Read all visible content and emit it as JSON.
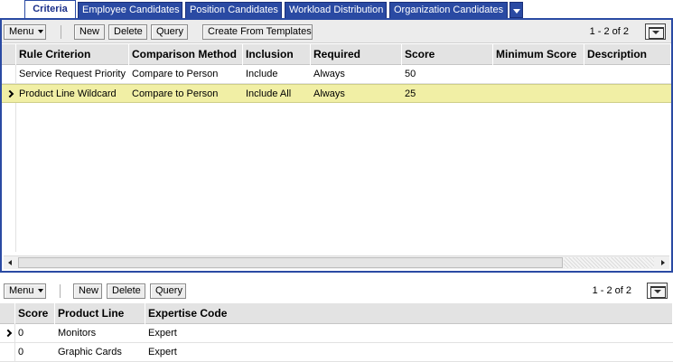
{
  "tabs": [
    {
      "label": "Criteria",
      "active": true
    },
    {
      "label": "Employee Candidates",
      "active": false
    },
    {
      "label": "Position Candidates",
      "active": false
    },
    {
      "label": "Workload Distribution",
      "active": false
    },
    {
      "label": "Organization Candidates",
      "active": false
    }
  ],
  "top_applet": {
    "toolbar": {
      "menu_label": "Menu",
      "new_label": "New",
      "delete_label": "Delete",
      "query_label": "Query",
      "templates_label": "Create From Templates",
      "record_count": "1 - 2 of 2"
    },
    "columns": [
      "Rule Criterion",
      "Comparison Method",
      "Inclusion",
      "Required",
      "Score",
      "Minimum Score",
      "Description"
    ],
    "rows": [
      {
        "rule_criterion": "Service Request Priority",
        "comparison_method": "Compare to Person",
        "inclusion": "Include",
        "required": "Always",
        "score": "50",
        "minimum_score": "",
        "description": "",
        "selected": false
      },
      {
        "rule_criterion": "Product Line Wildcard",
        "comparison_method": "Compare to Person",
        "inclusion": "Include All",
        "required": "Always",
        "score": "25",
        "minimum_score": "",
        "description": "",
        "selected": true
      }
    ]
  },
  "bottom_applet": {
    "toolbar": {
      "menu_label": "Menu",
      "new_label": "New",
      "delete_label": "Delete",
      "query_label": "Query",
      "record_count": "1 - 2 of 2"
    },
    "columns": [
      "Score",
      "Product Line",
      "Expertise Code"
    ],
    "rows": [
      {
        "score": "0",
        "product_line": "Monitors",
        "expertise_code": "Expert",
        "selected": true
      },
      {
        "score": "0",
        "product_line": "Graphic Cards",
        "expertise_code": "Expert",
        "selected": false
      }
    ]
  },
  "colors": {
    "tab_blue": "#2a4aa3",
    "selected_row": "#f1efa5",
    "header_gray": "#e3e3e3"
  }
}
